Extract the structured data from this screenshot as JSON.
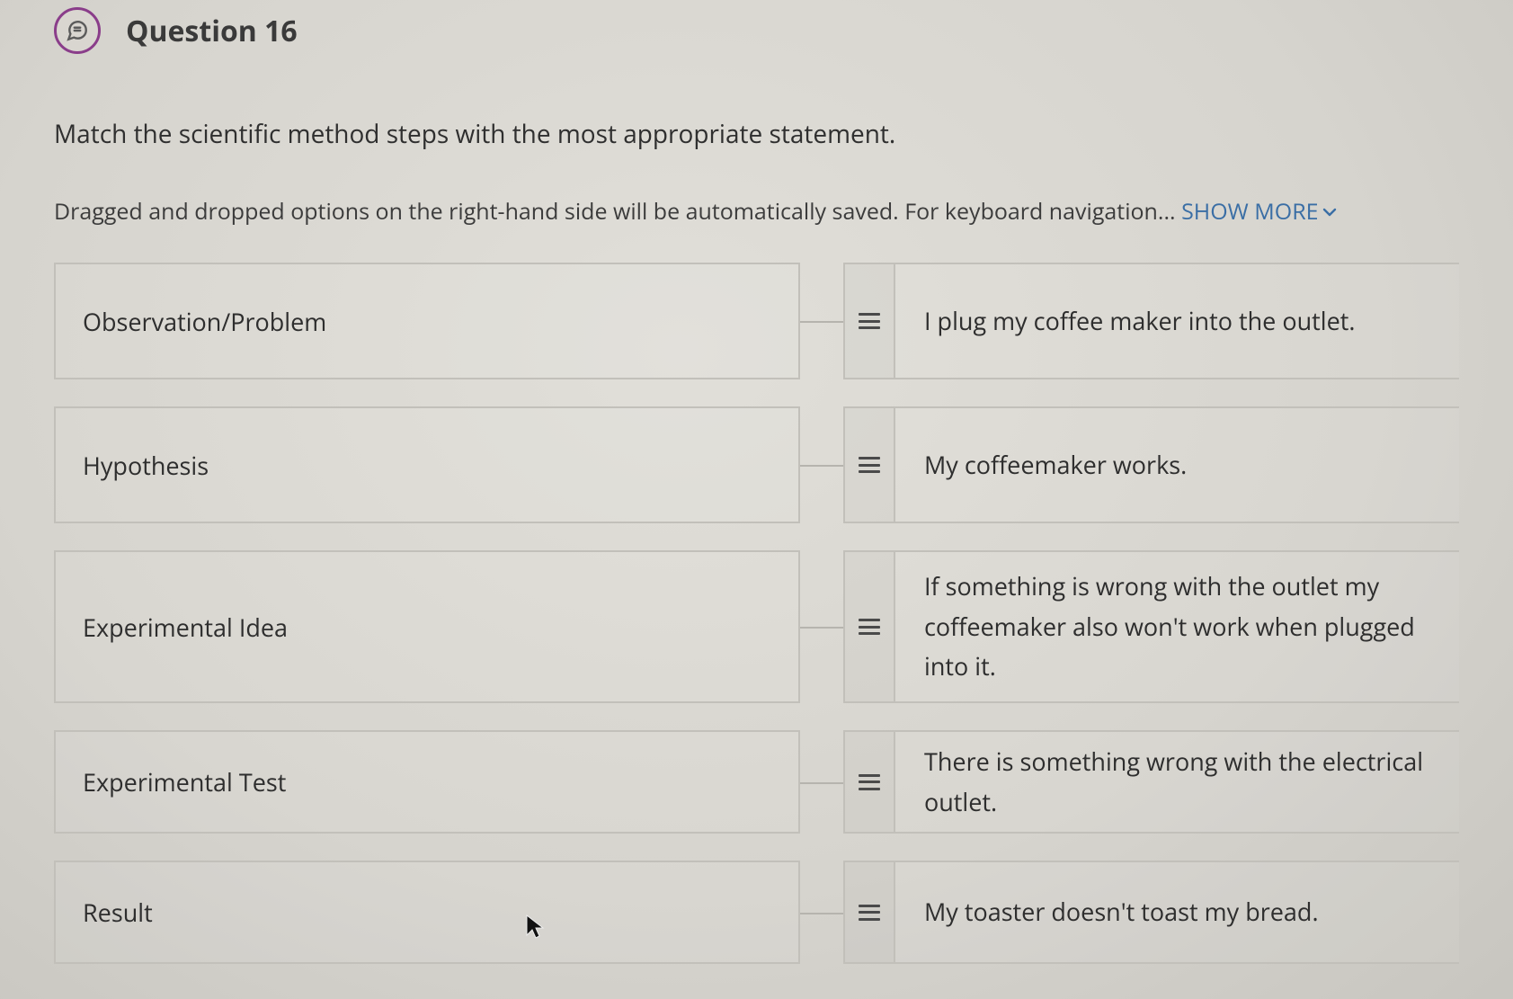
{
  "header": {
    "title": "Question 16"
  },
  "prompt": "Match the scientific method steps with the most appropriate statement.",
  "instructions_prefix": "Dragged and dropped options on the right-hand side will be automatically saved. For keyboard navigation... ",
  "show_more_label": "SHOW MORE",
  "rows": [
    {
      "left": "Observation/Problem",
      "right": "I plug my coffee maker into the outlet."
    },
    {
      "left": "Hypothesis",
      "right": "My coffeemaker works."
    },
    {
      "left": "Experimental Idea",
      "right": "If something is wrong with the outlet my coffeemaker also won't work when plugged into it."
    },
    {
      "left": "Experimental Test",
      "right": "There is something wrong with the electrical outlet."
    },
    {
      "left": "Result",
      "right": "My toaster doesn't toast my bread."
    }
  ]
}
